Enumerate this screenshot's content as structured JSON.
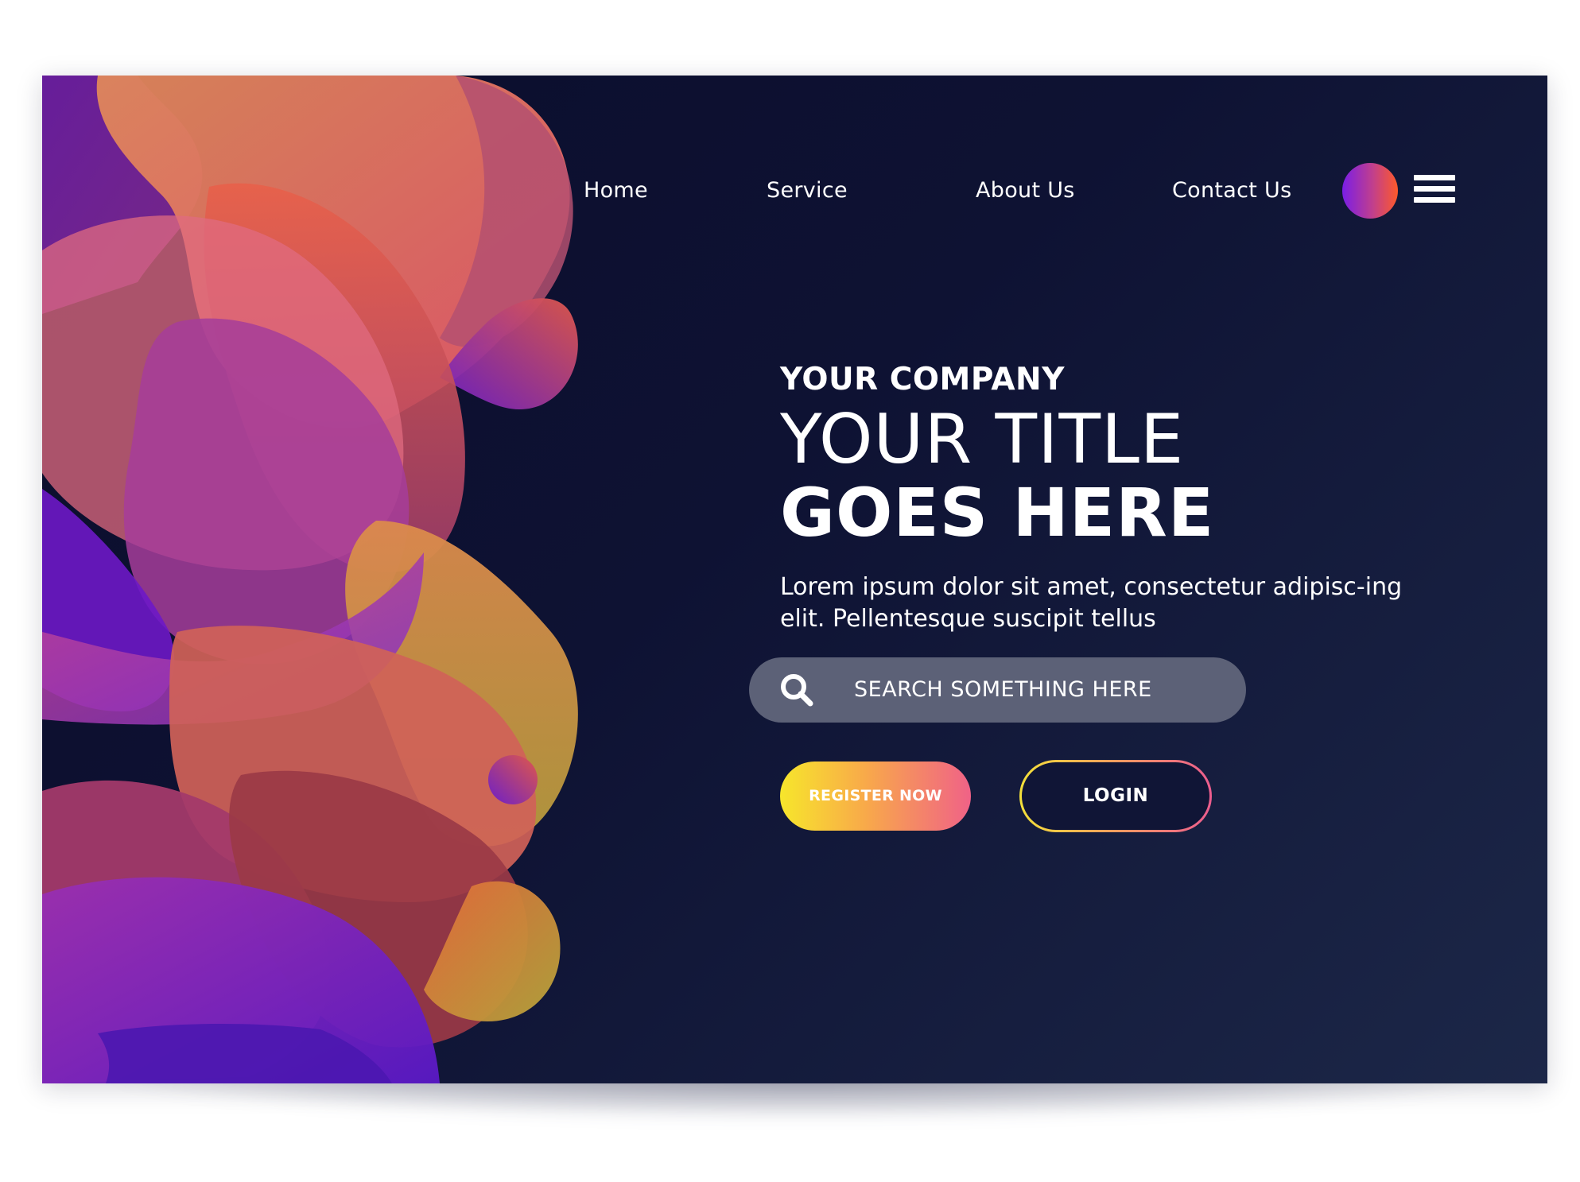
{
  "nav": {
    "links": [
      "Home",
      "Service",
      "About Us",
      "Contact Us"
    ]
  },
  "hero": {
    "company": "YOUR COMPANY",
    "title_line1": "YOUR TITLE",
    "title_line2": "GOES HERE",
    "description": "Lorem ipsum dolor sit amet, consectetur adipisc-ing elit. Pellentesque suscipit tellus"
  },
  "search": {
    "placeholder": "SEARCH SOMETHING HERE",
    "icon": "search-icon"
  },
  "buttons": {
    "register": "REGISTER NOW",
    "login": "LOGIN"
  },
  "icons": {
    "avatar": "avatar-gradient-circle",
    "menu": "hamburger-menu-icon"
  },
  "colors": {
    "background_dark": "#0b0d2c",
    "background_light": "#1c2748",
    "accent_yellow": "#f7e62b",
    "accent_pink": "#f06287",
    "accent_purple": "#7a1ee6",
    "accent_orange": "#ff5a2a",
    "search_bg": "#5c6177"
  }
}
